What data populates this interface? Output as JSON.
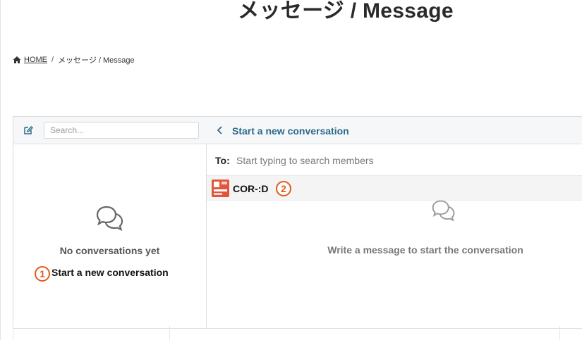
{
  "page": {
    "title": "メッセージ / Message"
  },
  "breadcrumb": {
    "home": "HOME",
    "separator": "/",
    "current": "メッセージ / Message"
  },
  "sidebar": {
    "search_placeholder": "Search...",
    "empty_title": "No conversations yet",
    "start_link": "Start a new conversation",
    "annotation": "1"
  },
  "conversation": {
    "header_title": "Start a new conversation",
    "to_label": "To:",
    "to_placeholder": "Start typing to search members",
    "member_name": "COR-:D",
    "annotation": "2",
    "empty_message": "Write a message to start the conversation"
  },
  "colors": {
    "accent": "#2d6a88",
    "annotation": "#e25a1c",
    "avatar": "#e2553d"
  },
  "icons": [
    "home-icon",
    "compose-icon",
    "back-chevron-icon",
    "chat-bubbles-icon"
  ]
}
